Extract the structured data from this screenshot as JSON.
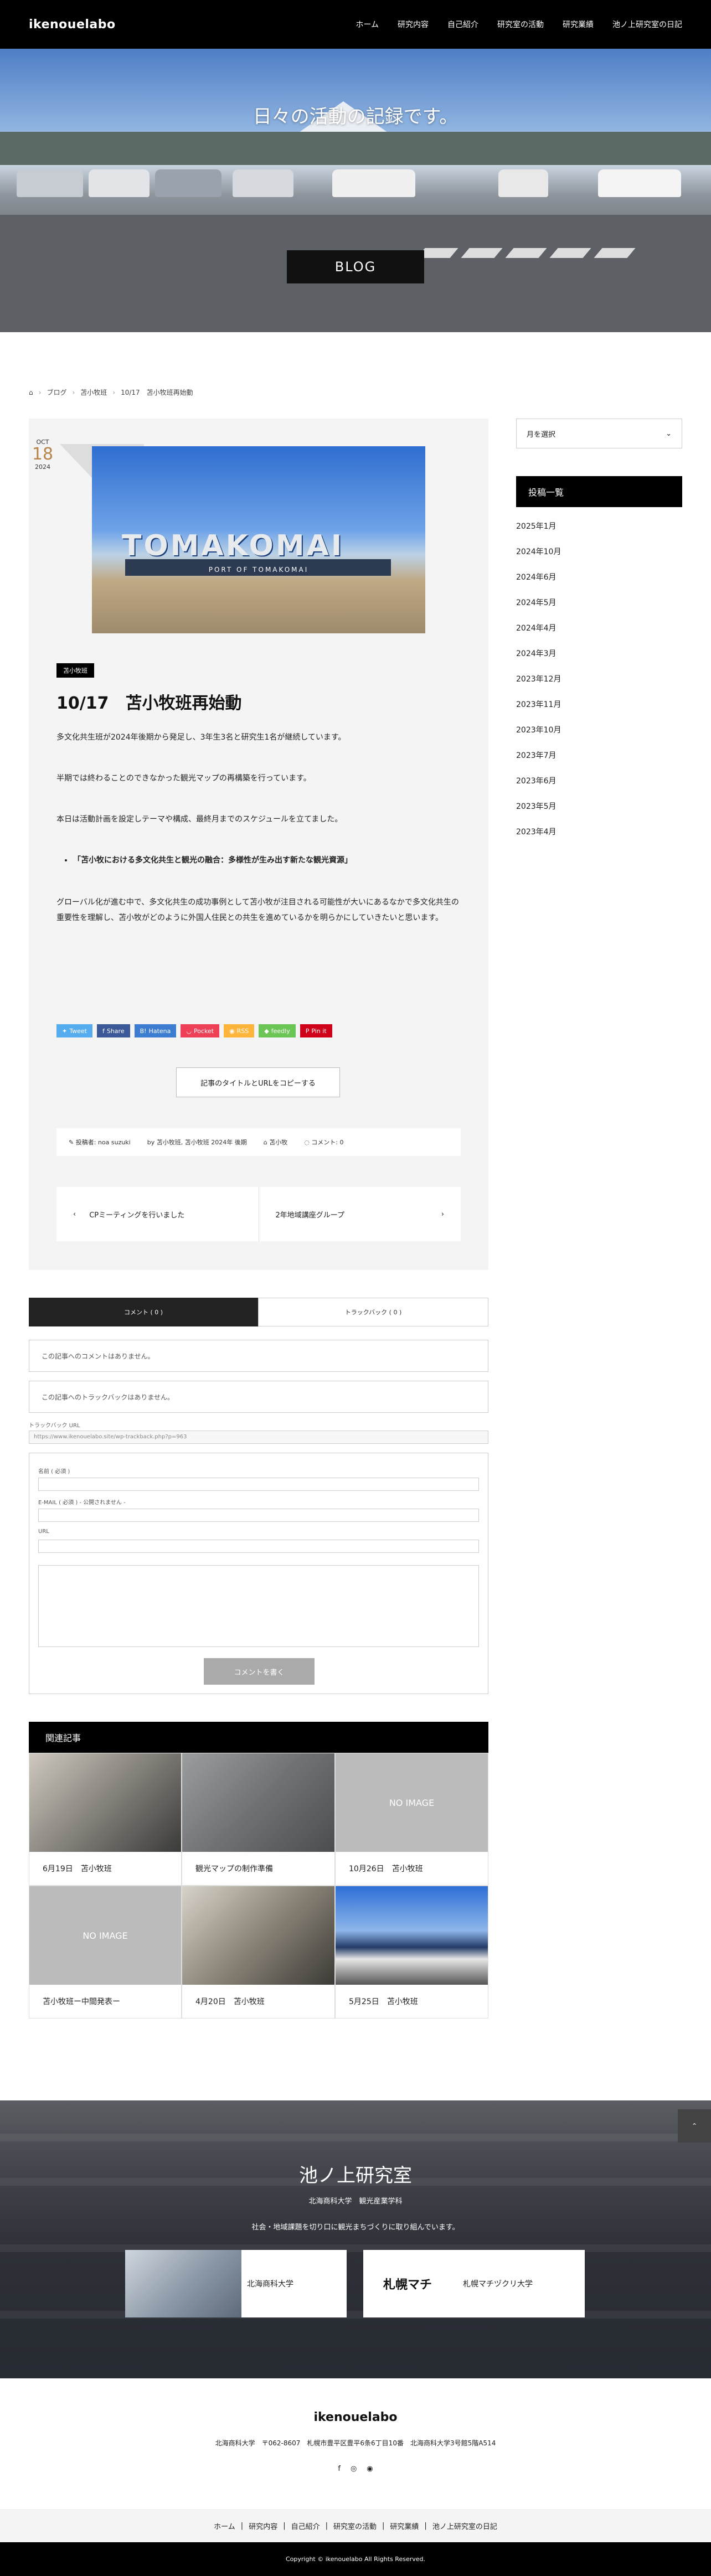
{
  "header": {
    "logo": "ikenouelabo",
    "nav": [
      "ホーム",
      "研究内容",
      "自己紹介",
      "研究室の活動",
      "研究業績",
      "池ノ上研究室の日記"
    ]
  },
  "hero": {
    "tagline": "日々の活動の記録です。",
    "label": "BLOG"
  },
  "breadcrumb": [
    "ブログ",
    "苫小牧班",
    "10/17　苫小牧班再始動"
  ],
  "article": {
    "date_month": "OCT",
    "date_day": "18",
    "date_year": "2024",
    "photo_sign": "TOMAKOMAI",
    "photo_sub": "PORT OF TOMAKOMAI",
    "category": "苫小牧班",
    "title": "10/17　苫小牧班再始動",
    "paragraphs": [
      "多文化共生班が2024年後期から発足し、3年生3名と研究生1名が継続しています。",
      "半期では終わることのできなかった観光マップの再構築を行っています。",
      "本日は活動計画を設定しテーマや構成、最終月までのスケジュールを立てました。"
    ],
    "bullet": "「苫小牧における多文化共生と観光の融合：多様性が生み出す新たな観光資源」",
    "closing": "グローバル化が進む中で、多文化共生の成功事例として苫小牧が注目される可能性が大いにあるなかで多文化共生の重要性を理解し、苫小牧がどのように外国人住民との共生を進めているかを明らかにしていきたいと思います。",
    "share": [
      {
        "label": "Tweet",
        "icon": "twitter-icon",
        "color": "#55acee"
      },
      {
        "label": "Share",
        "icon": "facebook-icon",
        "color": "#3b5998"
      },
      {
        "label": "Hatena",
        "icon": "hatena-icon",
        "color": "#3c7dd1"
      },
      {
        "label": "Pocket",
        "icon": "pocket-icon",
        "color": "#ee4056"
      },
      {
        "label": "RSS",
        "icon": "rss-icon",
        "color": "#ffb53c"
      },
      {
        "label": "feedly",
        "icon": "feedly-icon",
        "color": "#6cc655"
      },
      {
        "label": "Pin it",
        "icon": "pinterest-icon",
        "color": "#d0021b"
      }
    ],
    "copy_button": "記事のタイトルとURLをコピーする",
    "meta": {
      "author": "投稿者: noa suzuki",
      "by": "by  苫小牧班, 苫小牧班 2024年 後期",
      "tag": "苫小牧",
      "comments": "コメント: 0"
    },
    "prev_post": "CPミーティングを行いました",
    "next_post": "2年地域講座グループ"
  },
  "comments": {
    "tab_comments": "コメント ( 0 )",
    "tab_trackbacks": "トラックバック ( 0 )",
    "no_comments": "この記事へのコメントはありません。",
    "no_trackbacks": "この記事へのトラックバックはありません。",
    "trackback_label": "トラックバック URL",
    "trackback_url": "https://www.ikenouelabo.site/wp-trackback.php?p=963",
    "name_label": "名前 ( 必須 )",
    "email_label": "E-MAIL ( 必須 ) - 公開されません -",
    "url_label": "URL",
    "submit": "コメントを書く"
  },
  "related": {
    "heading": "関連記事",
    "items": [
      {
        "title": "6月19日　苫小牧班",
        "noimage": ""
      },
      {
        "title": "観光マップの制作準備",
        "noimage": ""
      },
      {
        "title": "10月26日　苫小牧班",
        "noimage": "NO IMAGE"
      },
      {
        "title": "苫小牧班ー中間発表ー",
        "noimage": "NO IMAGE"
      },
      {
        "title": "4月20日　苫小牧班",
        "noimage": ""
      },
      {
        "title": "5月25日　苫小牧班",
        "noimage": ""
      }
    ]
  },
  "sidebar": {
    "month_select": "月を選択",
    "heading": "投稿一覧",
    "archives": [
      "2025年1月",
      "2024年10月",
      "2024年6月",
      "2024年5月",
      "2024年4月",
      "2024年3月",
      "2023年12月",
      "2023年11月",
      "2023年10月",
      "2023年7月",
      "2023年6月",
      "2023年5月",
      "2023年4月"
    ]
  },
  "footer_hero": {
    "title": "池ノ上研究室",
    "sub1": "北海商科大学　観光産業学科",
    "sub2": "社会・地域課題を切り口に観光まちづくりに取り組んでいます。",
    "banner1": "北海商科大学",
    "banner2_logo": "札幌マチ",
    "banner2": "札幌マチヅクリ大学",
    "totop": "PAGE TOP"
  },
  "footer": {
    "logo": "ikenouelabo",
    "address": "北海商科大学　〒062-8607　札幌市豊平区豊平6条6丁目10番　北海商科大学3号館5階A514",
    "nav": [
      "ホーム",
      "研究内容",
      "自己紹介",
      "研究室の活動",
      "研究業績",
      "池ノ上研究室の日記"
    ],
    "copyright": "Copyright © ikenouelabo All Rights Reserved."
  }
}
